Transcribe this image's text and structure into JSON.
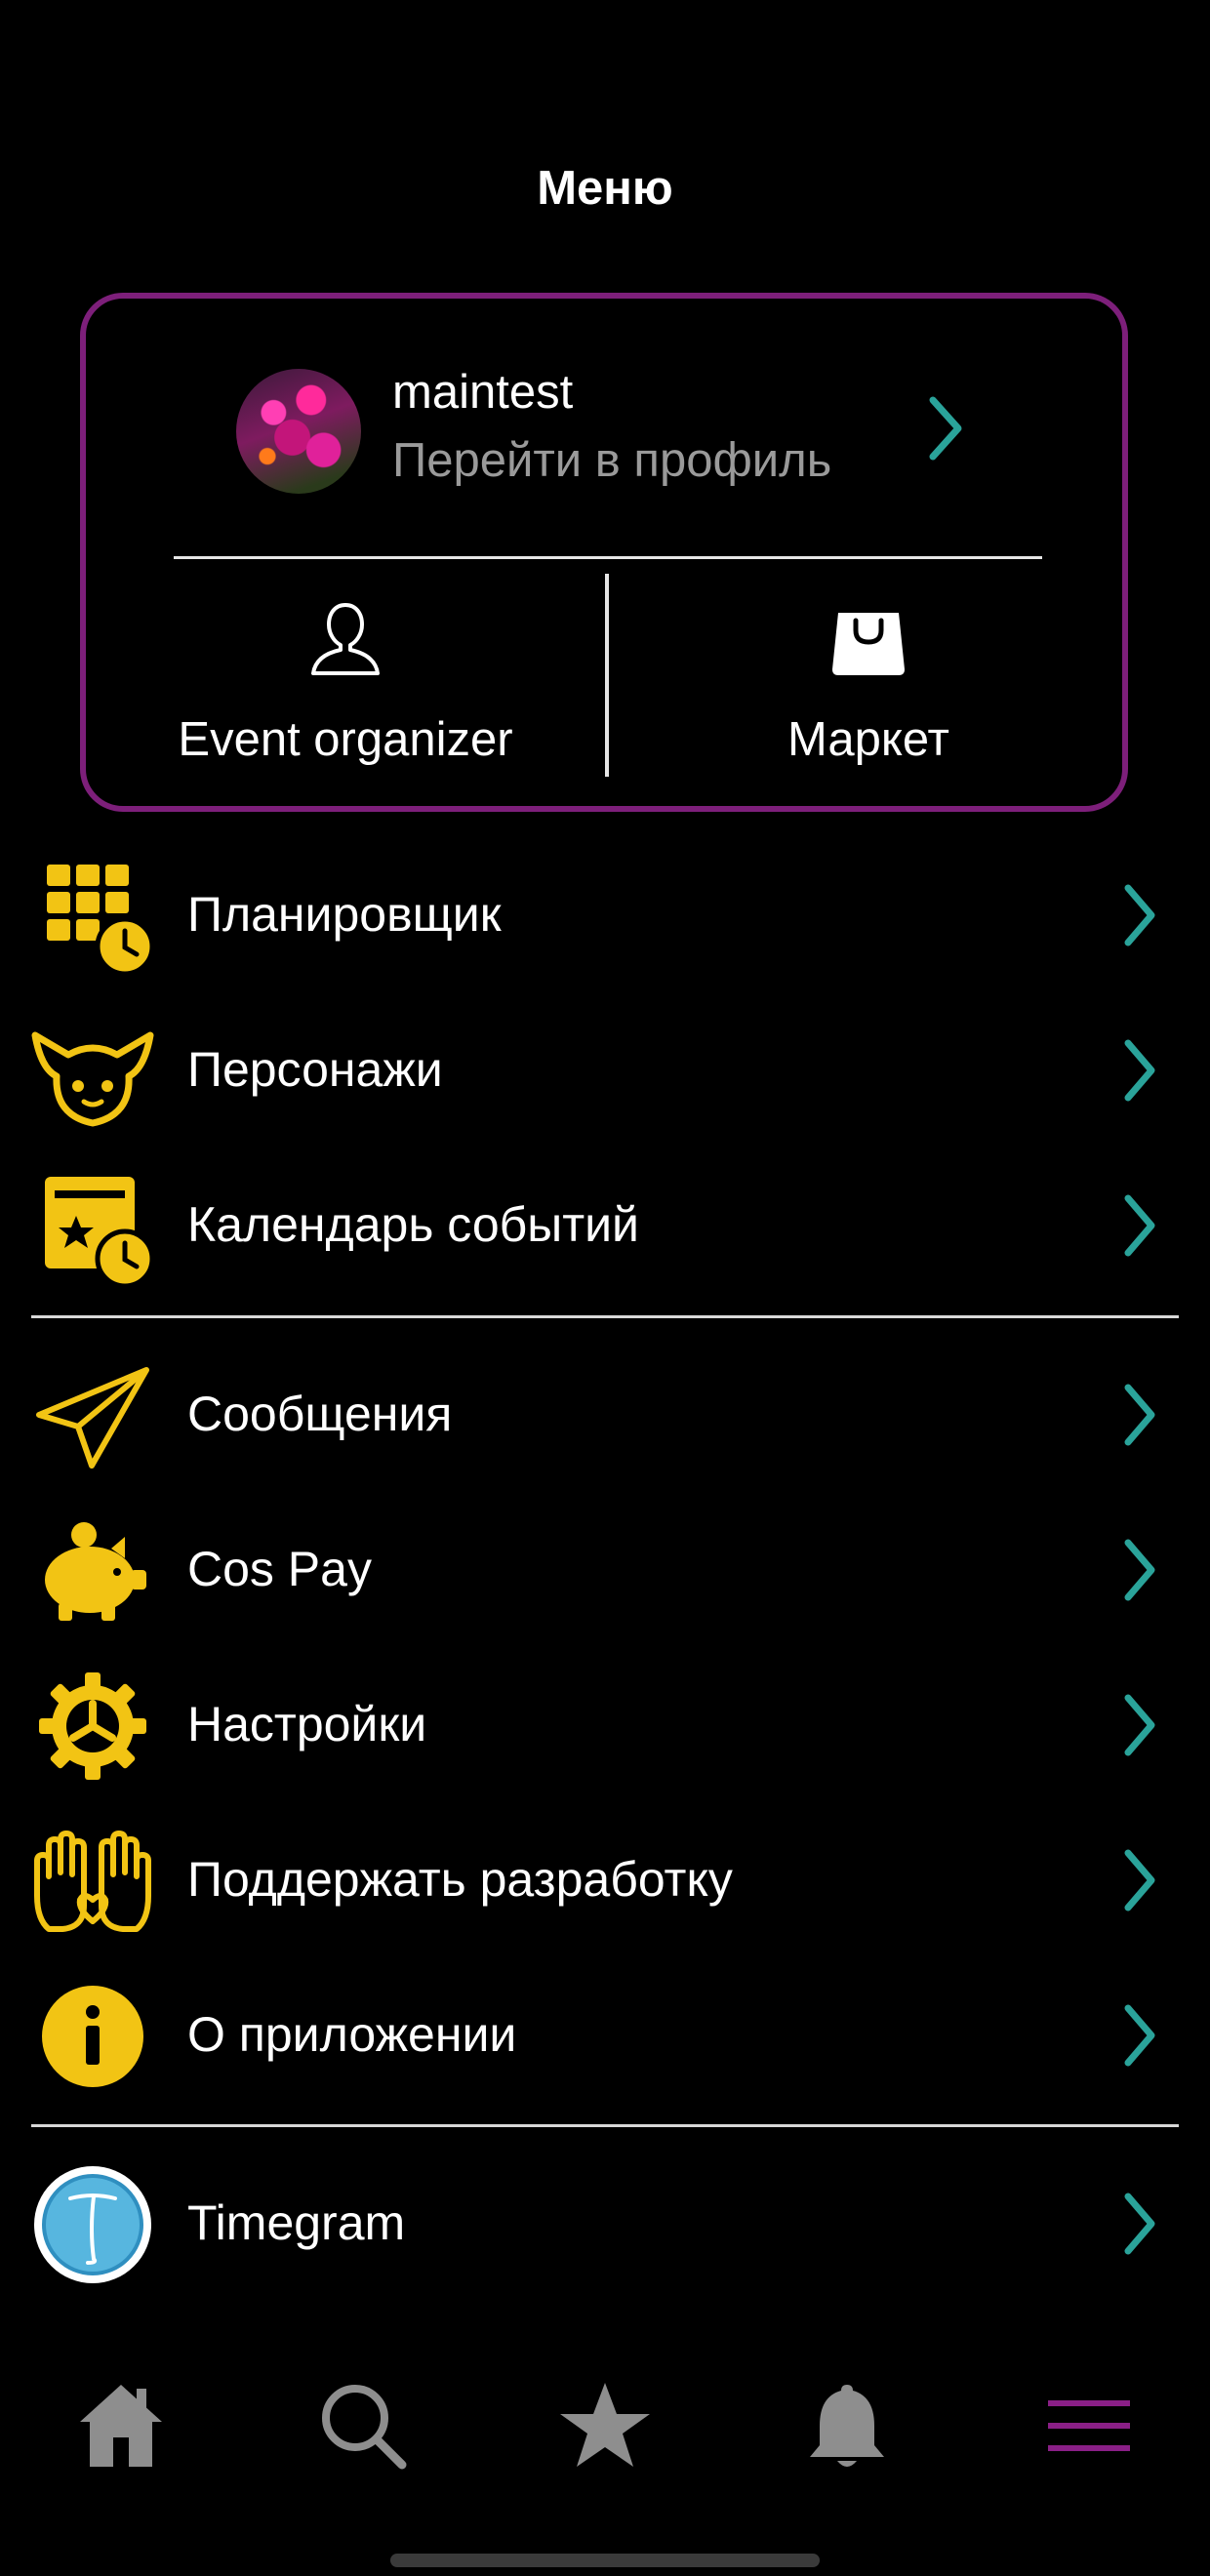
{
  "header": {
    "title": "Меню"
  },
  "profile": {
    "username": "maintest",
    "link_label": "Перейти в профиль",
    "avatar_icon": "avatar-flower-photo"
  },
  "quick_actions": [
    {
      "label": "Event organizer",
      "icon": "user-outline-icon"
    },
    {
      "label": "Маркет",
      "icon": "shopping-bag-icon"
    }
  ],
  "menu_groups": [
    [
      {
        "label": "Планировщик",
        "icon": "planner-grid-clock-icon"
      },
      {
        "label": "Персонажи",
        "icon": "character-face-icon"
      },
      {
        "label": "Календарь событий",
        "icon": "event-calendar-clock-icon"
      }
    ],
    [
      {
        "label": "Сообщения",
        "icon": "paper-plane-icon"
      },
      {
        "label": "Cos Pay",
        "icon": "piggy-bank-icon"
      },
      {
        "label": "Настройки",
        "icon": "gear-icon"
      },
      {
        "label": "Поддержать разработку",
        "icon": "hands-heart-icon"
      },
      {
        "label": "О приложении",
        "icon": "info-icon"
      }
    ],
    [
      {
        "label": "Timegram",
        "icon": "timegram-logo-icon"
      }
    ]
  ],
  "tabbar": {
    "items": [
      "home-icon",
      "search-icon",
      "star-icon",
      "bell-icon",
      "menu-icon"
    ],
    "active": "menu-icon"
  },
  "colors": {
    "background": "#000000",
    "accent_yellow": "#f2c414",
    "chevron_teal": "#2aa39a",
    "card_border": "#7d1f7a",
    "tab_inactive": "#8e8e8e",
    "tab_active": "#8a1f86"
  }
}
